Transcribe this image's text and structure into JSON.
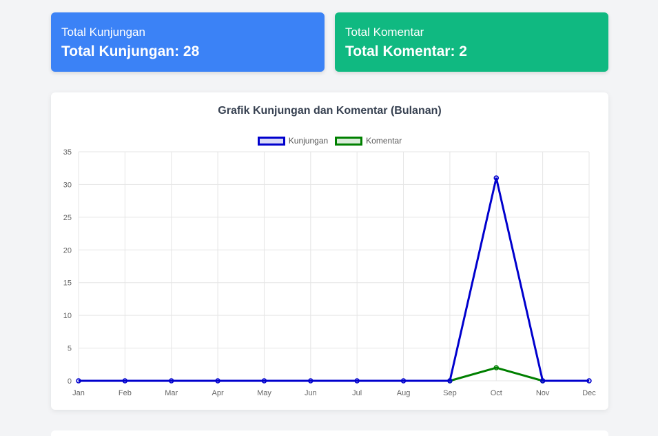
{
  "stats": {
    "visits_label": "Total Kunjungan",
    "visits_value": "Total Kunjungan: 28",
    "comments_label": "Total Komentar",
    "comments_value": "Total Komentar: 2"
  },
  "colors": {
    "visits_card": "#3b82f6",
    "comments_card": "#10b981",
    "visits_line": "#0000cd",
    "comments_line": "#008000"
  },
  "chart_data": {
    "type": "line",
    "title": "Grafik Kunjungan dan Komentar (Bulanan)",
    "categories": [
      "Jan",
      "Feb",
      "Mar",
      "Apr",
      "May",
      "Jun",
      "Jul",
      "Aug",
      "Sep",
      "Oct",
      "Nov",
      "Dec"
    ],
    "series": [
      {
        "name": "Kunjungan",
        "values": [
          0,
          0,
          0,
          0,
          0,
          0,
          0,
          0,
          0,
          31,
          0,
          0
        ]
      },
      {
        "name": "Komentar",
        "values": [
          null,
          null,
          null,
          null,
          null,
          null,
          null,
          null,
          0,
          2,
          0,
          null
        ]
      }
    ],
    "ylim": [
      0,
      35
    ],
    "yticks": [
      0,
      5,
      10,
      15,
      20,
      25,
      30,
      35
    ],
    "grid": true,
    "legend": "top-center"
  }
}
